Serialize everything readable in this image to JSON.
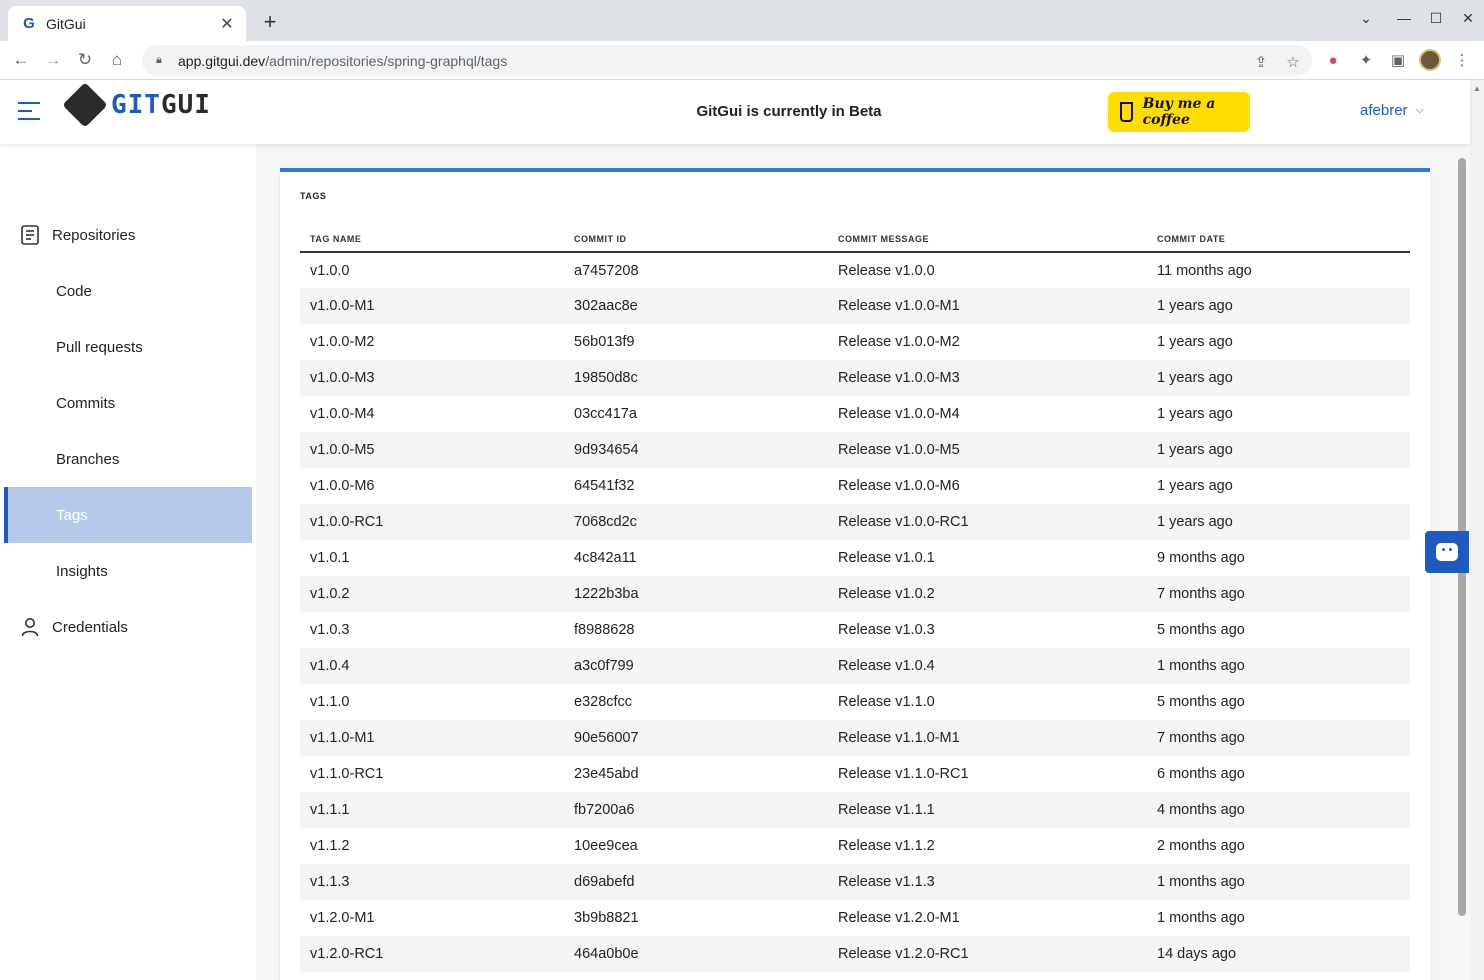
{
  "browser": {
    "tab_title": "GitGui",
    "favicon": "G",
    "url_host": "app.gitgui.dev",
    "url_path": "/admin/repositories/spring-graphql/tags"
  },
  "header": {
    "logo_git": "GIT",
    "logo_gui": "GUI",
    "beta_notice": "GitGui is currently in Beta",
    "coffee_label": "Buy me a coffee",
    "username": "afebrer",
    "accent_color": "#1f5bbf",
    "coffee_color": "#ffdd00"
  },
  "sidebar": {
    "items": [
      {
        "label": "Repositories",
        "icon": "document-list-icon"
      },
      {
        "label": "Code"
      },
      {
        "label": "Pull requests"
      },
      {
        "label": "Commits"
      },
      {
        "label": "Branches"
      },
      {
        "label": "Tags",
        "active": true
      },
      {
        "label": "Insights"
      },
      {
        "label": "Credentials",
        "icon": "person-icon"
      }
    ]
  },
  "tags": {
    "title": "TAGS",
    "columns": [
      "TAG NAME",
      "COMMIT ID",
      "COMMIT MESSAGE",
      "COMMIT DATE"
    ],
    "rows": [
      [
        "v1.0.0",
        "a7457208",
        "Release v1.0.0",
        "11 months ago"
      ],
      [
        "v1.0.0-M1",
        "302aac8e",
        "Release v1.0.0-M1",
        "1 years ago"
      ],
      [
        "v1.0.0-M2",
        "56b013f9",
        "Release v1.0.0-M2",
        "1 years ago"
      ],
      [
        "v1.0.0-M3",
        "19850d8c",
        "Release v1.0.0-M3",
        "1 years ago"
      ],
      [
        "v1.0.0-M4",
        "03cc417a",
        "Release v1.0.0-M4",
        "1 years ago"
      ],
      [
        "v1.0.0-M5",
        "9d934654",
        "Release v1.0.0-M5",
        "1 years ago"
      ],
      [
        "v1.0.0-M6",
        "64541f32",
        "Release v1.0.0-M6",
        "1 years ago"
      ],
      [
        "v1.0.0-RC1",
        "7068cd2c",
        "Release v1.0.0-RC1",
        "1 years ago"
      ],
      [
        "v1.0.1",
        "4c842a11",
        "Release v1.0.1",
        "9 months ago"
      ],
      [
        "v1.0.2",
        "1222b3ba",
        "Release v1.0.2",
        "7 months ago"
      ],
      [
        "v1.0.3",
        "f8988628",
        "Release v1.0.3",
        "5 months ago"
      ],
      [
        "v1.0.4",
        "a3c0f799",
        "Release v1.0.4",
        "1 months ago"
      ],
      [
        "v1.1.0",
        "e328cfcc",
        "Release v1.1.0",
        "5 months ago"
      ],
      [
        "v1.1.0-M1",
        "90e56007",
        "Release v1.1.0-M1",
        "7 months ago"
      ],
      [
        "v1.1.0-RC1",
        "23e45abd",
        "Release v1.1.0-RC1",
        "6 months ago"
      ],
      [
        "v1.1.1",
        "fb7200a6",
        "Release v1.1.1",
        "4 months ago"
      ],
      [
        "v1.1.2",
        "10ee9cea",
        "Release v1.1.2",
        "2 months ago"
      ],
      [
        "v1.1.3",
        "d69abefd",
        "Release v1.1.3",
        "1 months ago"
      ],
      [
        "v1.2.0-M1",
        "3b9b8821",
        "Release v1.2.0-M1",
        "1 months ago"
      ],
      [
        "v1.2.0-RC1",
        "464a0b0e",
        "Release v1.2.0-RC1",
        "14 days ago"
      ]
    ]
  }
}
